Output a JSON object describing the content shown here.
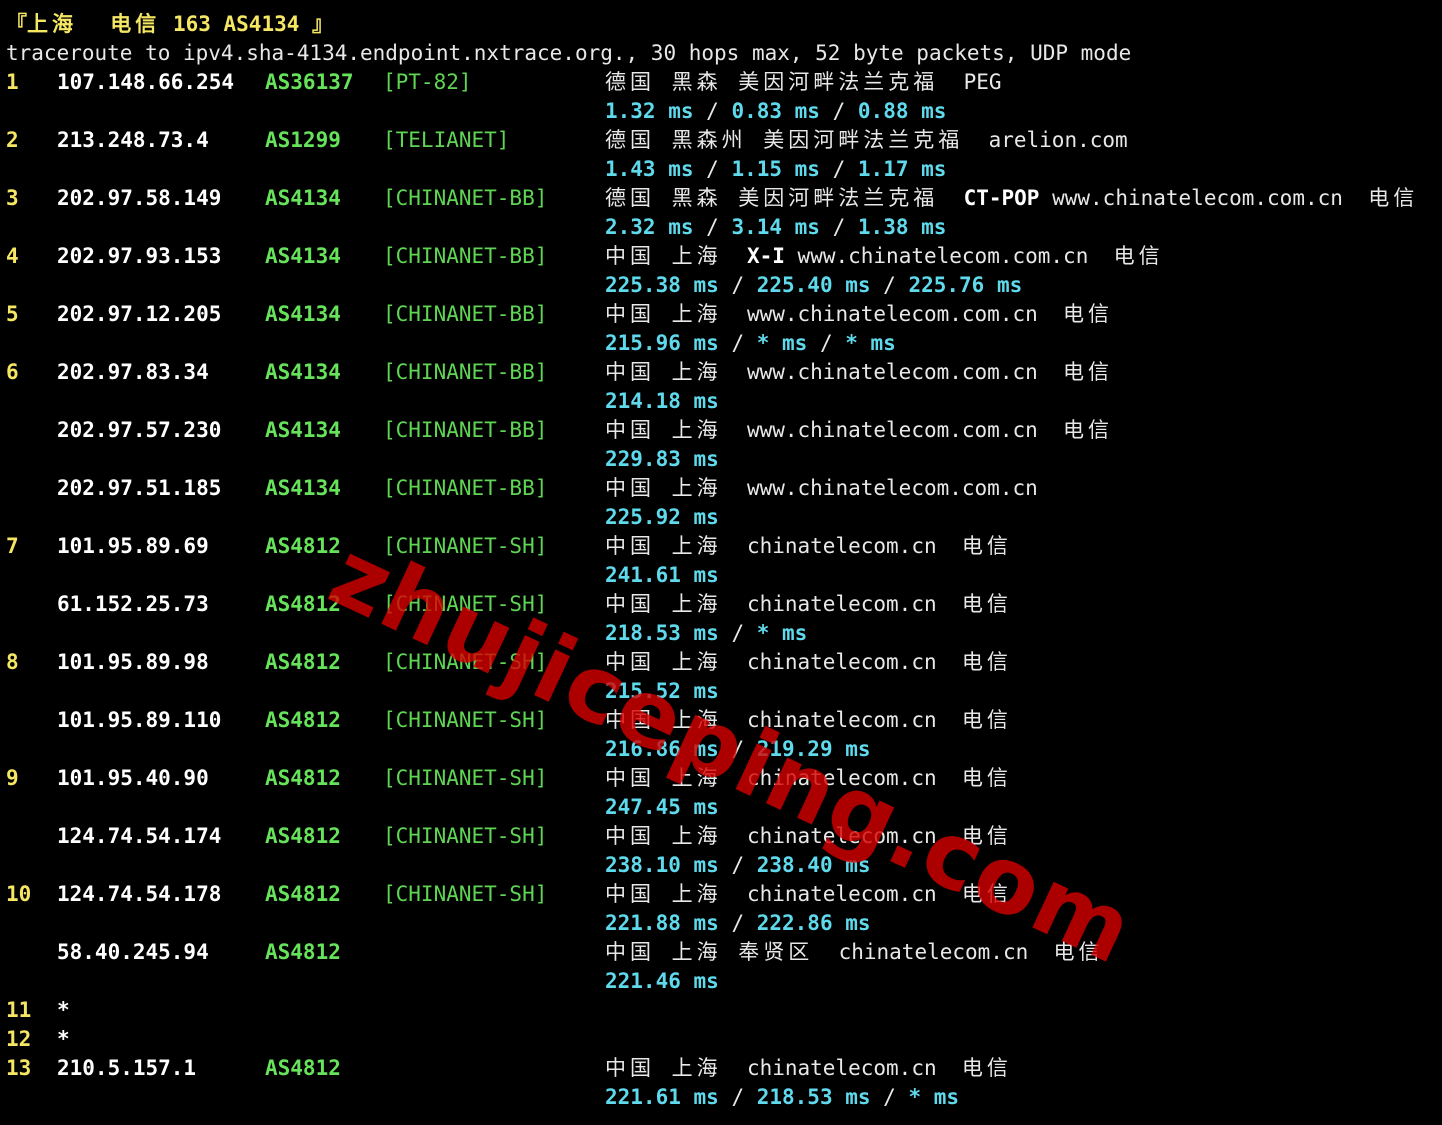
{
  "header": {
    "bracket_open": "『",
    "location": "上海  电信",
    "asn_label": "163 AS4134",
    "bracket_close": "』",
    "command": "traceroute to ipv4.sha-4134.endpoint.nxtrace.org., 30 hops max, 52 byte packets, UDP mode"
  },
  "hops": [
    {
      "hop": "1",
      "ip": "107.148.66.254",
      "asn": "AS36137",
      "tag": "[PT-82]",
      "geo": "德国 黑森 美因河畔法兰克福",
      "extra": "",
      "host": "PEG",
      "isp": "",
      "latency": [
        "1.32 ms",
        "0.83 ms",
        "0.88 ms"
      ]
    },
    {
      "hop": "2",
      "ip": "213.248.73.4",
      "asn": "AS1299",
      "tag": "[TELIANET]",
      "geo": "德国 黑森州 美因河畔法兰克福",
      "extra": "",
      "host": "arelion.com",
      "isp": "",
      "latency": [
        "1.43 ms",
        "1.15 ms",
        "1.17 ms"
      ]
    },
    {
      "hop": "3",
      "ip": "202.97.58.149",
      "asn": "AS4134",
      "tag": "[CHINANET-BB]",
      "geo": "德国 黑森 美因河畔法兰克福",
      "extra": "CT-POP",
      "host": "www.chinatelecom.com.cn",
      "isp": "电信",
      "latency": [
        "2.32 ms",
        "3.14 ms",
        "1.38 ms"
      ]
    },
    {
      "hop": "4",
      "ip": "202.97.93.153",
      "asn": "AS4134",
      "tag": "[CHINANET-BB]",
      "geo": "中国 上海",
      "extra": "X-I",
      "host": "www.chinatelecom.com.cn",
      "isp": "电信",
      "latency": [
        "225.38 ms",
        "225.40 ms",
        "225.76 ms"
      ]
    },
    {
      "hop": "5",
      "ip": "202.97.12.205",
      "asn": "AS4134",
      "tag": "[CHINANET-BB]",
      "geo": "中国 上海",
      "extra": "",
      "host": "www.chinatelecom.com.cn",
      "isp": "电信",
      "latency": [
        "215.96 ms",
        "* ms",
        "* ms"
      ]
    },
    {
      "hop": "6",
      "ip": "202.97.83.34",
      "asn": "AS4134",
      "tag": "[CHINANET-BB]",
      "geo": "中国 上海",
      "extra": "",
      "host": "www.chinatelecom.com.cn",
      "isp": "电信",
      "latency": [
        "214.18 ms"
      ]
    },
    {
      "hop": "",
      "ip": "202.97.57.230",
      "asn": "AS4134",
      "tag": "[CHINANET-BB]",
      "geo": "中国 上海",
      "extra": "",
      "host": "www.chinatelecom.com.cn",
      "isp": "电信",
      "latency": [
        "229.83 ms"
      ]
    },
    {
      "hop": "",
      "ip": "202.97.51.185",
      "asn": "AS4134",
      "tag": "[CHINANET-BB]",
      "geo": "中国 上海",
      "extra": "",
      "host": "www.chinatelecom.com.cn",
      "isp": "",
      "latency": [
        "225.92 ms"
      ]
    },
    {
      "hop": "7",
      "ip": "101.95.89.69",
      "asn": "AS4812",
      "tag": "[CHINANET-SH]",
      "geo": "中国 上海",
      "extra": "",
      "host": "chinatelecom.cn",
      "isp": "电信",
      "latency": [
        "241.61 ms"
      ]
    },
    {
      "hop": "",
      "ip": "61.152.25.73",
      "asn": "AS4812",
      "tag": "[CHINANET-SH]",
      "geo": "中国 上海",
      "extra": "",
      "host": "chinatelecom.cn",
      "isp": "电信",
      "latency": [
        "218.53 ms",
        "* ms"
      ]
    },
    {
      "hop": "8",
      "ip": "101.95.89.98",
      "asn": "AS4812",
      "tag": "[CHINANET-SH]",
      "geo": "中国 上海",
      "extra": "",
      "host": "chinatelecom.cn",
      "isp": "电信",
      "latency": [
        "215.52 ms"
      ]
    },
    {
      "hop": "",
      "ip": "101.95.89.110",
      "asn": "AS4812",
      "tag": "[CHINANET-SH]",
      "geo": "中国 上海",
      "extra": "",
      "host": "chinatelecom.cn",
      "isp": "电信",
      "latency": [
        "216.86 ms",
        "219.29 ms"
      ]
    },
    {
      "hop": "9",
      "ip": "101.95.40.90",
      "asn": "AS4812",
      "tag": "[CHINANET-SH]",
      "geo": "中国 上海",
      "extra": "",
      "host": "chinatelecom.cn",
      "isp": "电信",
      "latency": [
        "247.45 ms"
      ]
    },
    {
      "hop": "",
      "ip": "124.74.54.174",
      "asn": "AS4812",
      "tag": "[CHINANET-SH]",
      "geo": "中国 上海",
      "extra": "",
      "host": "chinatelecom.cn",
      "isp": "电信",
      "latency": [
        "238.10 ms",
        "238.40 ms"
      ]
    },
    {
      "hop": "10",
      "ip": "124.74.54.178",
      "asn": "AS4812",
      "tag": "[CHINANET-SH]",
      "geo": "中国 上海",
      "extra": "",
      "host": "chinatelecom.cn",
      "isp": "电信",
      "latency": [
        "221.88 ms",
        "222.86 ms"
      ]
    },
    {
      "hop": "",
      "ip": "58.40.245.94",
      "asn": "AS4812",
      "tag": "",
      "geo": "中国 上海 奉贤区",
      "extra": "",
      "host": "chinatelecom.cn",
      "isp": "电信",
      "latency": [
        "221.46 ms"
      ]
    },
    {
      "hop": "11",
      "ip": "*",
      "asn": "",
      "tag": "",
      "geo": "",
      "extra": "",
      "host": "",
      "isp": "",
      "latency": []
    },
    {
      "hop": "12",
      "ip": "*",
      "asn": "",
      "tag": "",
      "geo": "",
      "extra": "",
      "host": "",
      "isp": "",
      "latency": []
    },
    {
      "hop": "13",
      "ip": "210.5.157.1",
      "asn": "AS4812",
      "tag": "",
      "geo": "中国 上海",
      "extra": "",
      "host": "chinatelecom.cn",
      "isp": "电信",
      "latency": [
        "221.61 ms",
        "218.53 ms",
        "* ms"
      ]
    }
  ],
  "watermark": "zhujiceping.com",
  "colors": {
    "background": "#000000",
    "hop_number": "#f5e663",
    "ip": "#ffffff",
    "asn": "#66e35a",
    "tag": "#5ed553",
    "latency": "#5fd9ec",
    "text": "#e8e8e8",
    "watermark": "#d70000"
  }
}
